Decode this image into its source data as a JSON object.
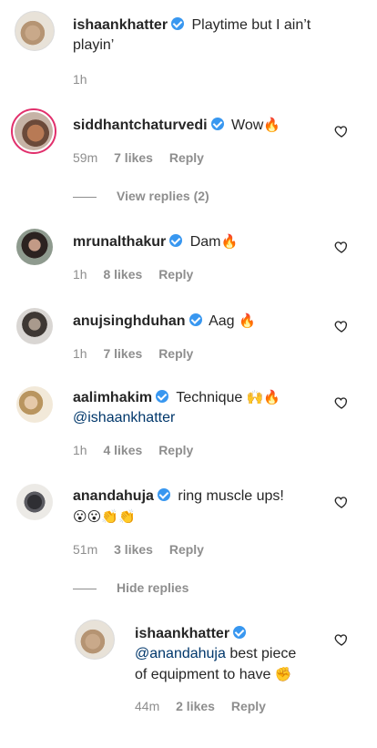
{
  "caption": {
    "username": "ishaankhatter",
    "text_line1": "Playtime but I ain’t",
    "text_line2": "playin’",
    "time": "1h"
  },
  "comments": [
    {
      "username": "siddhantchaturvedi",
      "text": "Wow",
      "emoji": "🔥",
      "time": "59m",
      "likes": "7 likes",
      "reply": "Reply"
    },
    {
      "username": "mrunalthakur",
      "text": "Dam",
      "emoji": "🔥",
      "time": "1h",
      "likes": "8 likes",
      "reply": "Reply"
    },
    {
      "username": "anujsinghduhan",
      "text": "Aag",
      "emoji": "🔥",
      "time": "1h",
      "likes": "7 likes",
      "reply": "Reply"
    },
    {
      "username": "aalimhakim",
      "text": "Technique",
      "emoji": "🙌🔥",
      "mention": "@ishaankhatter",
      "time": "1h",
      "likes": "4 likes",
      "reply": "Reply"
    },
    {
      "username": "anandahuja",
      "text": "ring muscle ups!",
      "emoji": "😮😮👏👏",
      "time": "51m",
      "likes": "3 likes",
      "reply": "Reply"
    }
  ],
  "view_replies": "View replies (2)",
  "hide_replies": "Hide replies",
  "reply_comment": {
    "username": "ishaankhatter",
    "mention": "@anandahuja",
    "text_line1": "best piece",
    "text_line2": "of equipment to have",
    "emoji": "✊",
    "time": "44m",
    "likes": "2 likes",
    "reply": "Reply"
  },
  "colors": {
    "verified": "#3897f0",
    "mention": "#00376b",
    "meta": "#8e8e8e",
    "story_ring": "#e1306c"
  },
  "icons": [
    "verified-badge-icon",
    "heart-outline-icon"
  ]
}
